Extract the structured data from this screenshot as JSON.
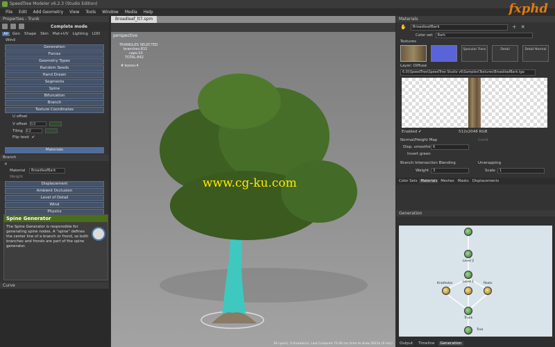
{
  "window": {
    "title": "SpeedTree Modeler v6.2.3 (Studio Edition)"
  },
  "menu": [
    "File",
    "Edit",
    "Add Geometry",
    "View",
    "Tools",
    "Window",
    "Media",
    "Help"
  ],
  "brand": {
    "logo": "fxphd",
    "color": "#e07a10"
  },
  "left_panel": {
    "title": "Properties - Trunk",
    "mode": "Complete mode",
    "tabs": [
      "All",
      "Gen",
      "Shape",
      "Skin",
      "Mat+UV",
      "Lighting",
      "LOD"
    ],
    "wind_tab": "Wind",
    "sections_top": [
      "Generation",
      "Forces",
      "Geometry Types",
      "Random Seeds",
      "Hand Drawn",
      "Segments",
      "Spine",
      "Bifurcation",
      "Branch",
      "Texture Coordinates"
    ],
    "props": {
      "u_offset": "U offset",
      "v_offset_label": "V offset",
      "v_offset_value": "0.3",
      "tiling_label": "Tiling",
      "tiling_value": "0.2",
      "flip_label": "Flip texd"
    },
    "materials_button": "Materials",
    "branch_section": {
      "title": "Branch",
      "material_label": "Material",
      "material_value": "BroadleafBark",
      "weight_label": "Weight"
    },
    "sections_bottom": [
      "Displacement",
      "Ambient Occlusion",
      "Level of Detail",
      "Wind",
      "Physics"
    ],
    "info": {
      "title": "Spine Generator",
      "text": "The Spine Generator is responsible for generating spine nodes. A \"spine\" defines the center line of a branch or frond, so both branches and fronds are part of the spine generator."
    },
    "curve_title": "Curve"
  },
  "viewport": {
    "doc_tab": "Broadleaf_lt7.spm",
    "perspective": "perspective",
    "stats": [
      "TRIANGLES  SELECTED",
      "branches:832",
      "caps:10",
      "TOTAL:842",
      "",
      "# bones:4"
    ],
    "status": "18 cpu(s), 0 threads(s), Last Compute 75.46 ms (tree to draw 2621k (0 ms))",
    "watermark": "www.cg-ku.com"
  },
  "right_panel": {
    "title": "Materials",
    "material_name": "BroadleafBark",
    "color_set_label": "Color set",
    "color_set_value": "Bark",
    "textures_label": "Textures",
    "texture_buttons": [
      "Specular Trans",
      "Detail",
      "Detail Normal"
    ],
    "layer_label": "Layer: Diffuse",
    "path": "6.0)\\SpeedTree\\SpeedTree Studio v6\\Samples\\Textures\\BroadleafBark.tga",
    "enabled_label": "Enabled",
    "resolution": "512x2048 RGB",
    "normal_map_label": "Normal/Height Map",
    "disp_smoothing_label": "Disp. smoothing",
    "disp_smoothing_value": "6",
    "invert_green_label": "Invert green",
    "branch_blend_label": "Branch Intersection Blending",
    "weight_label": "Weight",
    "weight_value": "3",
    "unwrapping_label": "Unwrapping",
    "scale_label": "Scale",
    "scale_value": "1",
    "cond_label": "Cond",
    "tabs": [
      "Color Sets",
      "Materials",
      "Meshes",
      "Masks",
      "Displacements"
    ],
    "generation": {
      "title": "Generation",
      "nodes": [
        "Level 2",
        "Level 1",
        "Knotholes",
        "Roots",
        "Trunk",
        "Tree"
      ]
    },
    "bottom_tabs": [
      "Output",
      "Timeline",
      "Generation"
    ]
  }
}
